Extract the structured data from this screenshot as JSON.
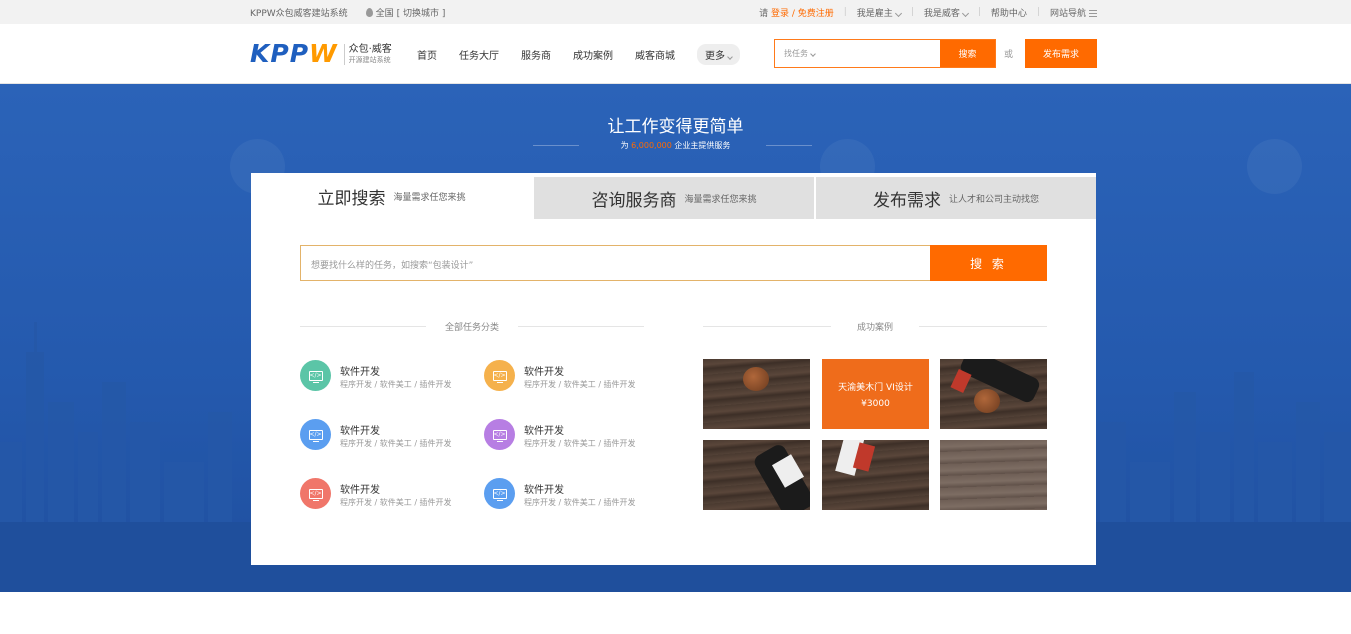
{
  "topbar": {
    "site_name": "KPPW众包威客建站系统",
    "location": "全国",
    "switch_city": "[ 切换城市 ]",
    "please": "请",
    "login": "登录",
    "slash": " / ",
    "register": "免费注册",
    "employer": "我是雇主",
    "witkey": "我是威客",
    "help": "帮助中心",
    "sitenav": "网站导航"
  },
  "header": {
    "logo_text_a": "KPP",
    "logo_text_b": "W",
    "logo_sub_a": "众包·威客",
    "logo_sub_b": "开源建站系统",
    "nav": [
      "首页",
      "任务大厅",
      "服务商",
      "成功案例",
      "威客商城"
    ],
    "more": "更多",
    "search_select": "找任务",
    "search_btn": "搜索",
    "or": "或",
    "post_btn": "发布需求"
  },
  "banner": {
    "slogan": "让工作变得更简单",
    "sub_prefix": "为",
    "sub_number": "6,000,000",
    "sub_suffix": "企业主提供服务"
  },
  "panel": {
    "tabs": [
      {
        "big": "立即搜索",
        "small": "海量需求任您来挑"
      },
      {
        "big": "咨询服务商",
        "small": "海量需求任您来挑"
      },
      {
        "big": "发布需求",
        "small": "让人才和公司主动找您"
      }
    ],
    "search_placeholder": "想要找什么样的任务，如搜索“包装设计”",
    "search_btn": "搜 索",
    "categories_title": "全部任务分类",
    "cases_title": "成功案例",
    "categories": [
      {
        "name": "软件开发",
        "desc": "程序开发 / 软件美工 / 插件开发",
        "color": "#5bc5a7"
      },
      {
        "name": "软件开发",
        "desc": "程序开发 / 软件美工 / 插件开发",
        "color": "#f5b14c"
      },
      {
        "name": "软件开发",
        "desc": "程序开发 / 软件美工 / 插件开发",
        "color": "#5b9ef0"
      },
      {
        "name": "软件开发",
        "desc": "程序开发 / 软件美工 / 插件开发",
        "color": "#b77ee3"
      },
      {
        "name": "软件开发",
        "desc": "程序开发 / 软件美工 / 插件开发",
        "color": "#f0766a"
      },
      {
        "name": "软件开发",
        "desc": "程序开发 / 软件美工 / 插件开发",
        "color": "#5b9ef0"
      }
    ],
    "case_highlight": {
      "title": "天渝美木门 VI设计",
      "price": "¥3000"
    }
  }
}
